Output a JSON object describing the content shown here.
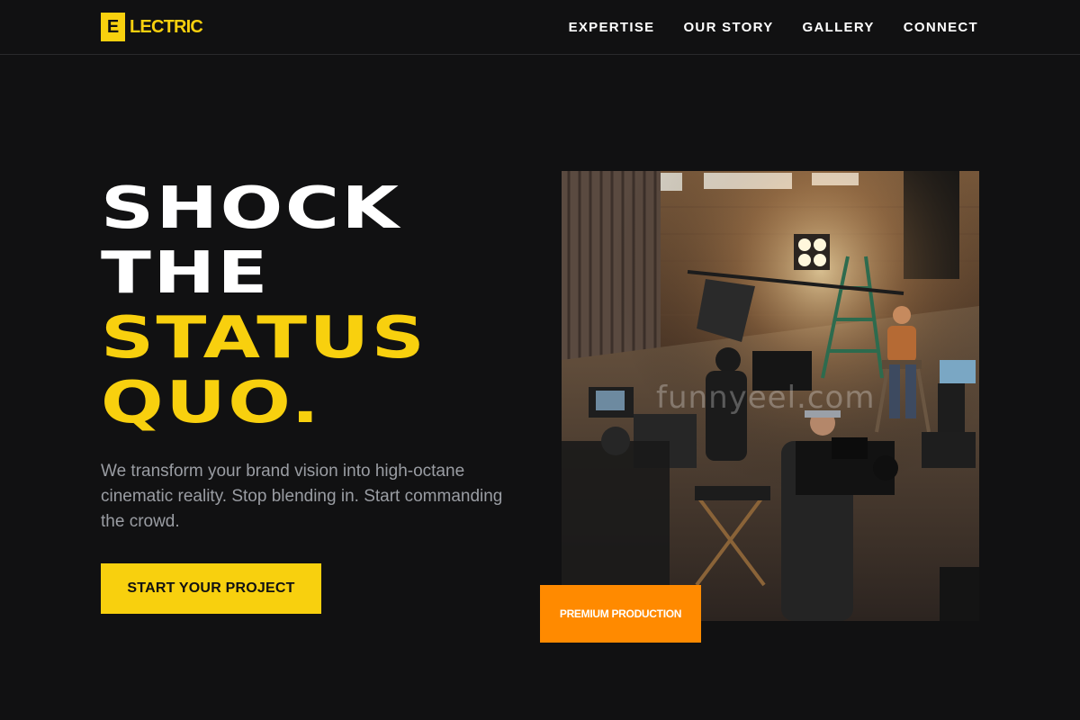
{
  "brand": {
    "mark": "E",
    "name": "LECTRIC"
  },
  "nav": {
    "items": [
      {
        "label": "EXPERTISE"
      },
      {
        "label": "OUR STORY"
      },
      {
        "label": "GALLERY"
      },
      {
        "label": "CONNECT"
      }
    ]
  },
  "hero": {
    "headline_lines": [
      "SHOCK",
      "THE",
      "STATUS",
      "QUO."
    ],
    "subtitle": "We transform your brand vision into high-octane cinematic reality. Stop blending in. Start commanding the crowd.",
    "cta_label": "START YOUR PROJECT",
    "badge_label": "PREMIUM PRODUCTION",
    "watermark": "funnyeel.com"
  },
  "colors": {
    "background": "#111112",
    "accent_yellow": "#f8d00e",
    "badge_orange": "#ff8a00",
    "subtitle_gray": "#9a9da3"
  }
}
